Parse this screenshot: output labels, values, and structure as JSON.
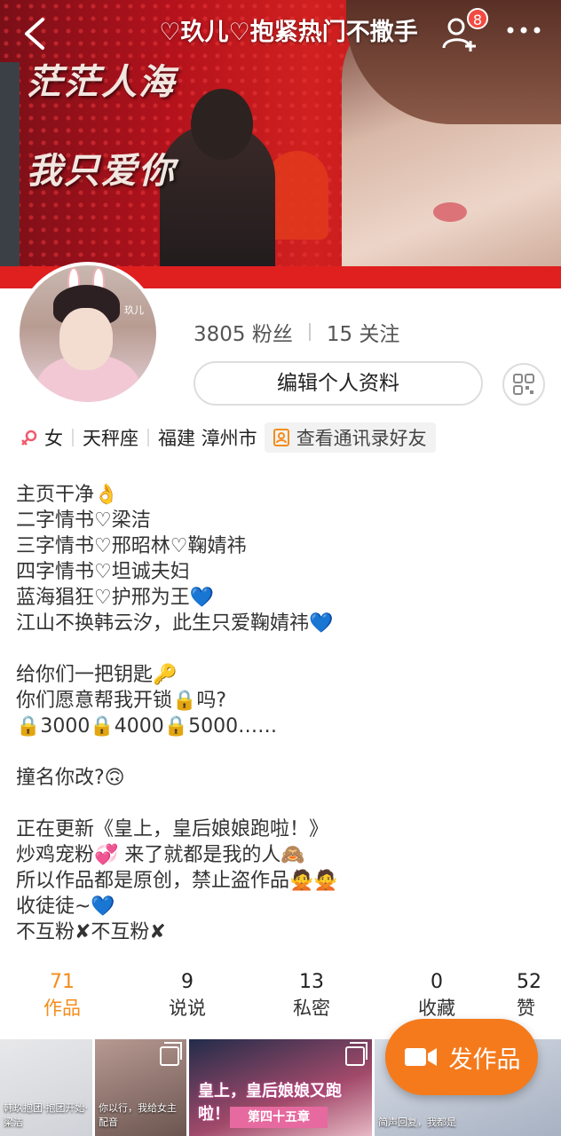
{
  "header": {
    "title": "♡玖儿♡抱紧热门不撒手",
    "notification_count": "8"
  },
  "cover": {
    "calligraphy_line1": "茫茫人海",
    "calligraphy_line2": "我只爱你"
  },
  "avatar": {
    "watermark": "玖儿"
  },
  "profile": {
    "followers": "3805 粉丝",
    "following": "15 关注",
    "edit_label": "编辑个人资料"
  },
  "tags": {
    "gender": "女",
    "zodiac": "天秤座",
    "location": "福建 漳州市",
    "contacts_label": "查看通讯录好友"
  },
  "bio": [
    "主页干净👌",
    "二字情书♡梁洁",
    "三字情书♡邢昭林♡鞠婧祎",
    "四字情书♡坦诚夫妇",
    "蓝海猖狂♡护邢为王💙",
    "江山不换韩云汐，此生只爱鞠婧祎💙",
    "",
    "给你们一把钥匙🔑",
    "你们愿意帮我开锁🔒吗?",
    "🔒3000🔒4000🔒5000……",
    "",
    "撞名你改?🙃",
    "",
    "正在更新《皇上，皇后娘娘跑啦！》",
    "炒鸡宠粉💞 来了就都是我的人🙈",
    "所以作品都是原创，禁止盗作品🙅🙅",
    "收徒徒~💙",
    "不互粉✘不互粉✘"
  ],
  "tabs": [
    {
      "num": "71",
      "label": "作品"
    },
    {
      "num": "9",
      "label": "说说"
    },
    {
      "num": "13",
      "label": "私密"
    },
    {
      "num": "0",
      "label": "收藏"
    },
    {
      "num": "52",
      "label": "赞"
    }
  ],
  "thumbnails": {
    "t1_caption": "韩玖抱团·抱团开始·梁洁",
    "t2_caption": "你以行，我给女主配音",
    "t3_title": "皇上，皇后娘娘又跑啦！",
    "t3_chapter": "第四十五章",
    "t4_caption": "简声回复，我都是"
  },
  "post_button": {
    "label": "发作品"
  },
  "colors": {
    "accent": "#f48d1b",
    "post_button": "#f57a1c",
    "badge": "#f24b42"
  }
}
